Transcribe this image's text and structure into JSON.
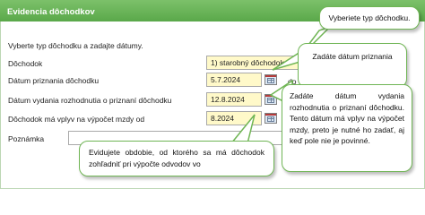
{
  "window": {
    "title": "Evidencia dôchodkov"
  },
  "form": {
    "instruction": "Vyberte typ dôchodku a zadajte dátumy.",
    "pension_type": {
      "label": "Dôchodok",
      "value": "1) starobný dôchodok"
    },
    "recognition_date": {
      "label": "Dátum priznania dôchodku",
      "value": "5.7.2024",
      "suffix": "do"
    },
    "decision_date": {
      "label": "Dátum vydania rozhodnutia o priznaní dôchodku",
      "value": "12.8.2024"
    },
    "affects_from": {
      "label": "Dôchodok má vplyv na výpočet mzdy od",
      "value": "8.2024"
    },
    "note": {
      "label": "Poznámka",
      "value": ""
    }
  },
  "callouts": {
    "type": "Vyberiete typ dôchodku.",
    "recognition": "Zadáte dátum priznania",
    "decision": "Zadáte dátum vydania rozhodnutia o priznaní dôchodku. Tento dátum má vplyv na výpočet mzdy, preto je nutné ho zadať, aj keď pole nie je povinné.",
    "period": "Evidujete obdobie, od ktorého sa má dôchodok zohľadniť pri výpočte odvodov vo"
  },
  "colors": {
    "title_bar": "#5aa84a",
    "callout_border": "#6fb554",
    "field_highlight": "#fff9c9"
  },
  "icons": {
    "calendar": "calendar-icon"
  }
}
